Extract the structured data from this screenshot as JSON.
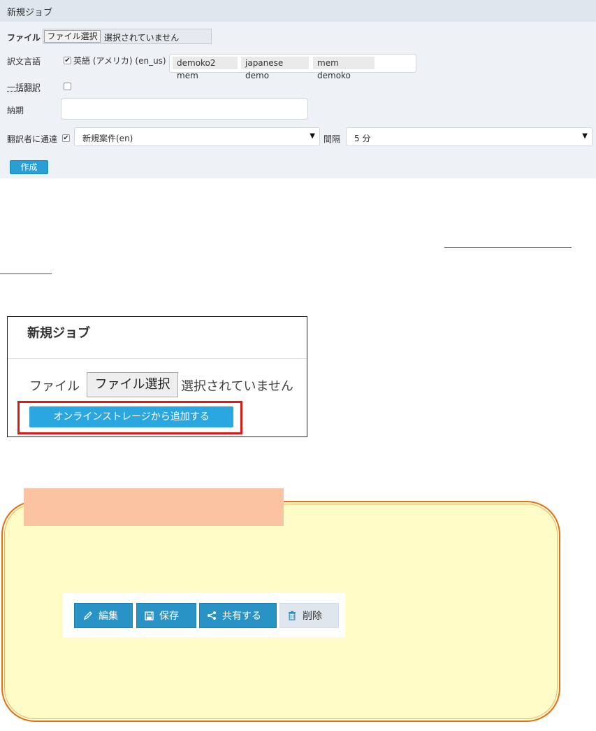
{
  "form": {
    "title": "新規ジョブ",
    "file_label": "ファイル",
    "file_button": "ファイル選択",
    "file_status": "選択されていません",
    "target_lang_label": "訳文言語",
    "target_lang_option": "英語 (アメリカ) (en_us)",
    "target_lang_checked": true,
    "tags": [
      "demoko2 mem",
      "japanese demo",
      "mem demoko"
    ],
    "bulk_translate_label": "一括翻訳",
    "bulk_translate_checked": false,
    "deadline_label": "納期",
    "deadline_value": "",
    "notify_translator_label": "翻訳者に通達",
    "notify_translator_checked": true,
    "template_select": "新規案件(en)",
    "interval_label": "間隔",
    "interval_select": "5 分",
    "create_button": "作成"
  },
  "zoom_panel": {
    "title": "新規ジョブ",
    "file_label": "ファイル",
    "file_button": "ファイル選択",
    "file_status": "選択されていません",
    "online_storage_button": "オンラインストレージから追加する",
    "highlight_color": "#e01818"
  },
  "callout": {
    "border_color": "#e0701a",
    "fill_color": "#fffcc8",
    "tab_color": "#fbc3a2",
    "toolbar": [
      {
        "label": "編集",
        "icon": "pencil-icon"
      },
      {
        "label": "保存",
        "icon": "save-icon"
      },
      {
        "label": "共有する",
        "icon": "share-icon"
      },
      {
        "label": "削除",
        "icon": "trash-icon"
      }
    ]
  }
}
